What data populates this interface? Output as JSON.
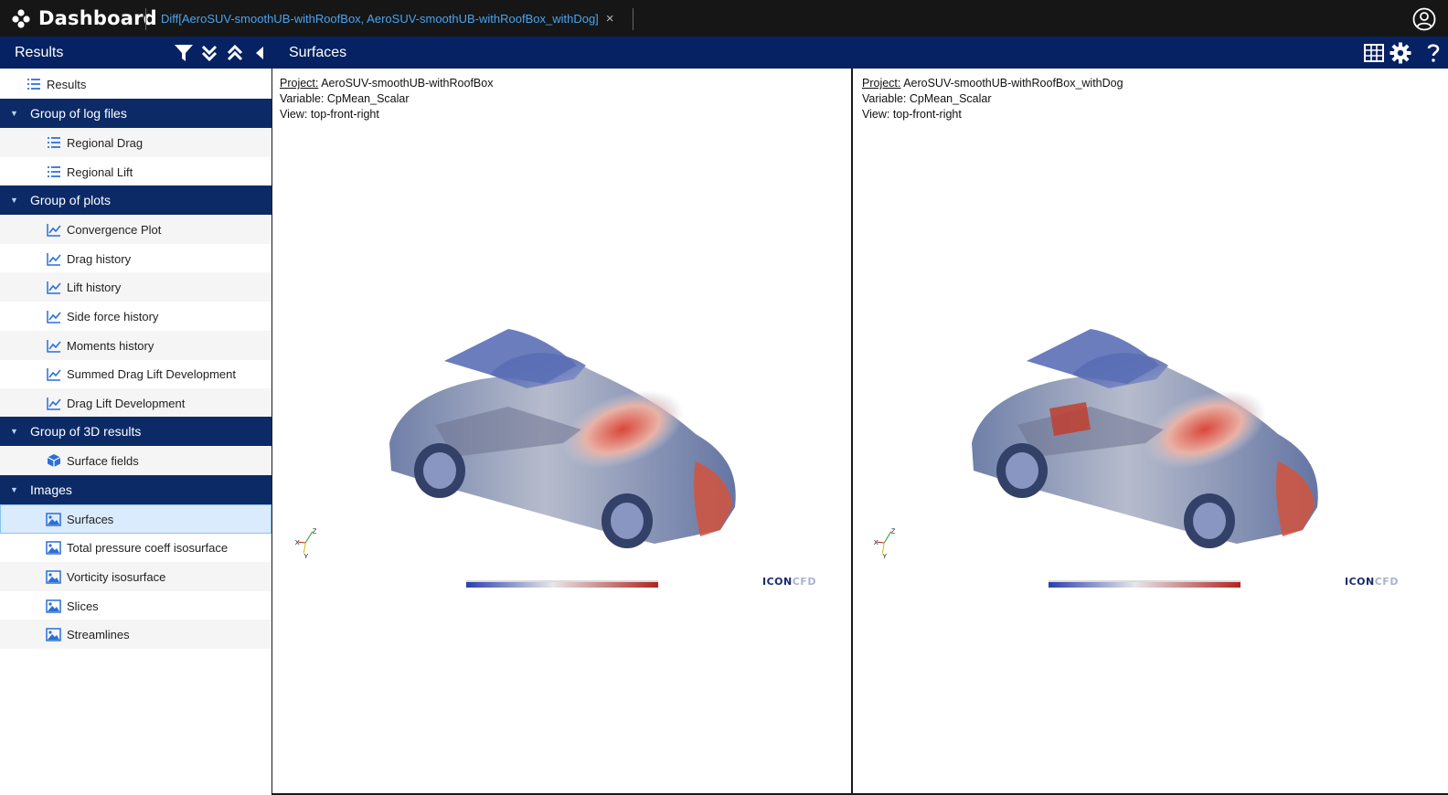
{
  "app": {
    "title": "Dashboard"
  },
  "tabs": [
    {
      "label": "Diff[AeroSUV-smoothUB-withRoofBox, AeroSUV-smoothUB-withRoofBox_withDog]",
      "close": "×"
    }
  ],
  "header": {
    "sidebar_title": "Results",
    "view_title": "Surfaces"
  },
  "icons": {
    "filter": "filter-icon",
    "expand_all": "double-chevron-down-icon",
    "collapse_all": "double-chevron-up-icon",
    "collapse_sidebar": "caret-left-icon",
    "grid": "grid-icon",
    "settings": "gear-icon",
    "help": "question-icon",
    "user": "user-circle-icon",
    "list": "list-icon",
    "chart": "line-chart-icon",
    "cube": "cube-icon",
    "image": "image-icon"
  },
  "colors": {
    "topbar": "#161616",
    "navbar": "#062262",
    "group": "#0c2a66",
    "selected": "#d9ebfd",
    "tab_text": "#4aa3f0"
  },
  "sidebar": {
    "root": "Results",
    "groups": [
      {
        "label": "Group of log files",
        "items": [
          "Regional Drag",
          "Regional Lift"
        ]
      },
      {
        "label": "Group of plots",
        "items": [
          "Convergence Plot",
          "Drag history",
          "Lift history",
          "Side force history",
          "Moments history",
          "Summed Drag Lift Development",
          "Drag Lift Development"
        ]
      },
      {
        "label": "Group of 3D results",
        "items": [
          "Surface fields"
        ]
      },
      {
        "label": "Images",
        "items": [
          "Surfaces",
          "Total pressure coeff isosurface",
          "Vorticity isosurface",
          "Slices",
          "Streamlines"
        ],
        "selected": "Surfaces"
      }
    ]
  },
  "panels": [
    {
      "project_key": "Project:",
      "project": "AeroSUV-smoothUB-withRoofBox",
      "variable": "Variable: CpMean_Scalar",
      "view": "View: top-front-right",
      "logo": "ICON",
      "logo_suffix": "CFD"
    },
    {
      "project_key": "Project:",
      "project": "AeroSUV-smoothUB-withRoofBox_withDog",
      "variable": "Variable: CpMean_Scalar",
      "view": "View: top-front-right",
      "logo": "ICON",
      "logo_suffix": "CFD"
    }
  ],
  "axes": {
    "z": "Z",
    "x": "X",
    "y": "Y"
  }
}
